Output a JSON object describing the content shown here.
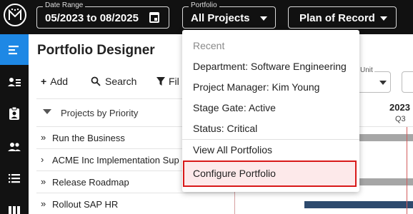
{
  "topbar": {
    "date_range": {
      "label": "Date Range",
      "value": "05/2023 to 08/2025"
    },
    "portfolio": {
      "label": "Portfolio",
      "value": "All Projects"
    },
    "plan": {
      "value": "Plan of Record"
    }
  },
  "page": {
    "title": "Portfolio Designer"
  },
  "toolbar": {
    "add_label": "Add",
    "search_label": "Search",
    "filter_label": "Fil"
  },
  "list": {
    "group_header": "Projects by Priority",
    "rows": [
      {
        "label": "Run the Business",
        "chevron": "»"
      },
      {
        "label": "ACME Inc Implementation Sup",
        "chevron": "›"
      },
      {
        "label": "Release Roadmap",
        "chevron": "»"
      },
      {
        "label": "Rollout SAP HR",
        "chevron": "»"
      }
    ]
  },
  "gantt": {
    "unit_label": "Unit",
    "year": "2023",
    "quarter": "Q3",
    "colors": {
      "gray_bar": "#a6a6a6",
      "navy_bar": "#2d4a6d",
      "today_line": "#d35a5a"
    }
  },
  "menu": {
    "section_label": "Recent",
    "recent_items": [
      "Department: Software Engineering",
      "Project Manager: Kim Young",
      "Stage Gate: Active",
      "Status: Critical"
    ],
    "view_all": "View All Portfolios",
    "configure": "Configure Portfolio"
  },
  "colors": {
    "topbar_bg": "#111111",
    "accent": "#1e88e5",
    "highlight_border": "#d81919",
    "highlight_bg": "#fde9ea"
  }
}
